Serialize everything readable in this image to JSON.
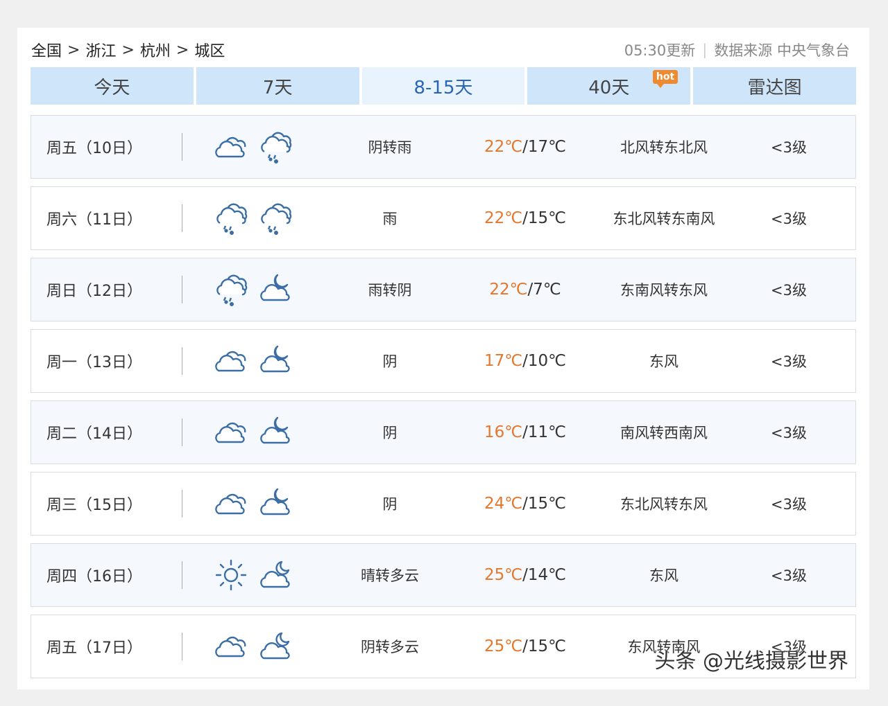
{
  "breadcrumb": {
    "items": [
      "全国",
      "浙江",
      "杭州",
      "城区"
    ],
    "separator": ">"
  },
  "meta": {
    "update_time": "05:30更新",
    "source": "数据来源 中央气象台"
  },
  "tabs": [
    {
      "label": "今天",
      "active": false
    },
    {
      "label": "7天",
      "active": false
    },
    {
      "label": "8-15天",
      "active": true
    },
    {
      "label": "40天",
      "active": false,
      "badge": "hot"
    },
    {
      "label": "雷达图",
      "active": false
    }
  ],
  "forecast": [
    {
      "day": "周五（10日）",
      "icon_day": "cloudy-icon",
      "icon_night": "rain-icon",
      "desc": "阴转雨",
      "high": "22℃",
      "low": "17℃",
      "wind": "北风转东北风",
      "level": "<3级"
    },
    {
      "day": "周六（11日）",
      "icon_day": "rain-icon",
      "icon_night": "rain-icon",
      "desc": "雨",
      "high": "22℃",
      "low": "15℃",
      "wind": "东北风转东南风",
      "level": "<3级"
    },
    {
      "day": "周日（12日）",
      "icon_day": "rain-icon",
      "icon_night": "night-cloudy-icon",
      "desc": "雨转阴",
      "high": "22℃",
      "low": "7℃",
      "wind": "东南风转东风",
      "level": "<3级"
    },
    {
      "day": "周一（13日）",
      "icon_day": "cloudy-icon",
      "icon_night": "night-cloudy-icon",
      "desc": "阴",
      "high": "17℃",
      "low": "10℃",
      "wind": "东风",
      "level": "<3级"
    },
    {
      "day": "周二（14日）",
      "icon_day": "cloudy-icon",
      "icon_night": "night-cloudy-icon",
      "desc": "阴",
      "high": "16℃",
      "low": "11℃",
      "wind": "南风转西南风",
      "level": "<3级"
    },
    {
      "day": "周三（15日）",
      "icon_day": "cloudy-icon",
      "icon_night": "night-cloudy-icon",
      "desc": "阴",
      "high": "24℃",
      "low": "15℃",
      "wind": "东北风转东风",
      "level": "<3级"
    },
    {
      "day": "周四（16日）",
      "icon_day": "sun-icon",
      "icon_night": "night-partly-cloudy-icon",
      "desc": "晴转多云",
      "high": "25℃",
      "low": "14℃",
      "wind": "东风",
      "level": "<3级"
    },
    {
      "day": "周五（17日）",
      "icon_day": "cloudy-icon",
      "icon_night": "night-partly-cloudy-icon",
      "desc": "阴转多云",
      "high": "25℃",
      "low": "15℃",
      "wind": "东风转南风",
      "level": "<3级"
    }
  ],
  "watermark": "头条 @光线摄影世界",
  "colors": {
    "tab_bg": "#cfe6fa",
    "tab_active_text": "#2a65b5",
    "high_temp": "#e6762a",
    "icon_stroke": "#3b6ea5",
    "hot_badge": "#f08a30"
  }
}
